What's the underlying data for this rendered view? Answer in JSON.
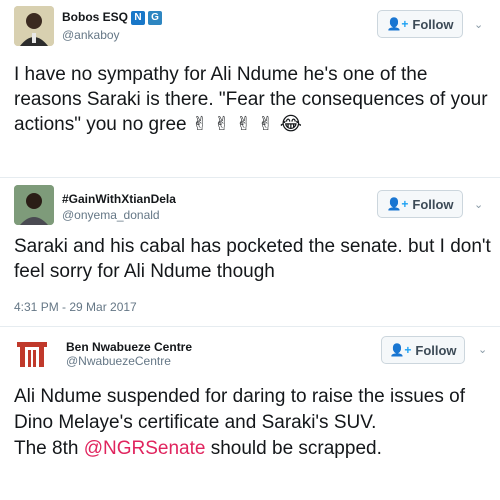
{
  "tweets": [
    {
      "name": "Bobos ESQ",
      "badge_n": "N",
      "badge_g": "G",
      "badge_n_color": "#1877c8",
      "badge_g_color": "#2e86c1",
      "handle": "@ankaboy",
      "follow_label": "Follow",
      "text": "I have no sympathy for Ali Ndume he's one of the reasons Saraki is there. \"Fear the consequences of your actions\" you no gree",
      "emojis": "✌ ✌ ✌ ✌ 😂",
      "avatar_icon": "person-photo"
    },
    {
      "name": "#GainWithXtianDela",
      "handle": "@onyema_donald",
      "follow_label": "Follow",
      "text": "Saraki and his cabal has pocketed the senate. but I don't feel sorry for Ali Ndume though",
      "timestamp": "4:31 PM - 29 Mar 2017",
      "avatar_icon": "person-photo"
    },
    {
      "name": "Ben Nwabueze Centre",
      "handle": "@NwabuezeCentre",
      "follow_label": "Follow",
      "text_line1": "Ali Ndume suspended for daring to raise the issues of Dino Melaye's certificate and Saraki's SUV.",
      "text_prefix": "The 8th ",
      "mention": "@NGRSenate",
      "text_suffix": " should be scrapped.",
      "avatar_icon": "gate-logo",
      "logo_color": "#c0392b"
    }
  ]
}
